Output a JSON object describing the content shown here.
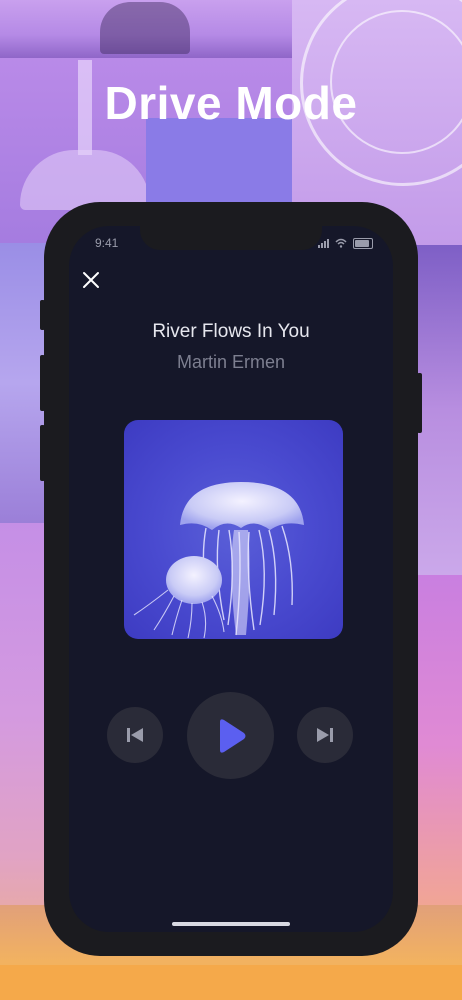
{
  "page": {
    "title": "Drive Mode"
  },
  "status_bar": {
    "time": "9:41"
  },
  "player": {
    "song_title": "River Flows In You",
    "artist": "Martin Ermen",
    "album_art_description": "",
    "controls": {
      "previous_icon": "skip-previous-icon",
      "play_icon": "play-icon",
      "next_icon": "skip-next-icon"
    },
    "close_icon": "close-icon"
  },
  "colors": {
    "accent": "#5b5ff0",
    "screen_background": "#151729",
    "control_background": "#2a2b38",
    "title_text": "#ffffff"
  }
}
